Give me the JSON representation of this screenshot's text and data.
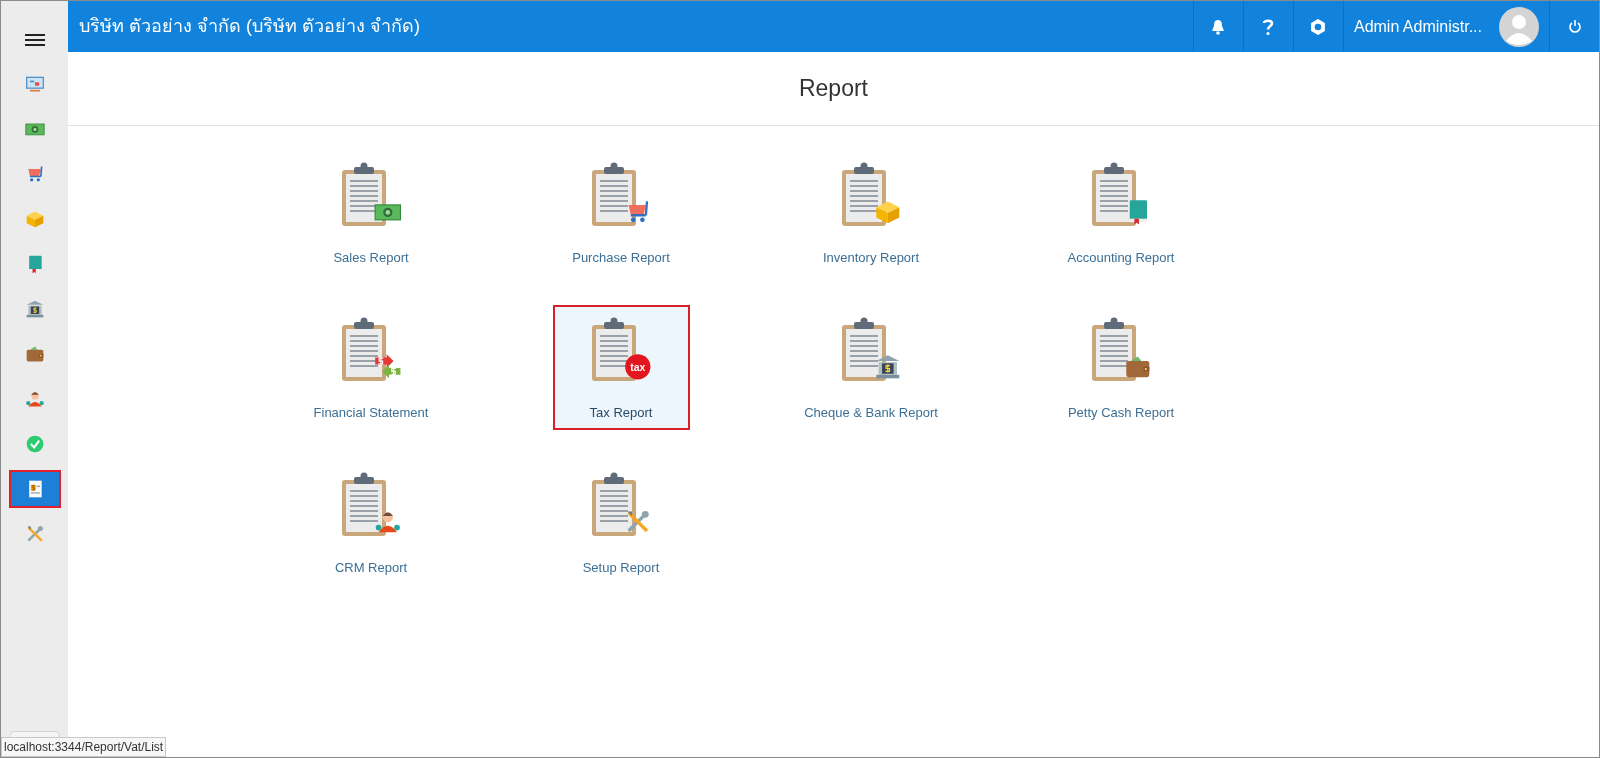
{
  "header": {
    "company": "บริษัท ตัวอย่าง จำกัด (บริษัท ตัวอย่าง จำกัด)",
    "user": "Admin Administr..."
  },
  "sidebar": {
    "items": [
      {
        "kind": "dashboard",
        "selected": false
      },
      {
        "kind": "money",
        "selected": false
      },
      {
        "kind": "cart",
        "selected": false
      },
      {
        "kind": "box",
        "selected": false
      },
      {
        "kind": "book",
        "selected": false
      },
      {
        "kind": "bank",
        "selected": false
      },
      {
        "kind": "wallet",
        "selected": false
      },
      {
        "kind": "people",
        "selected": false
      },
      {
        "kind": "check",
        "selected": false
      },
      {
        "kind": "report",
        "selected": true
      },
      {
        "kind": "tools",
        "selected": false
      }
    ]
  },
  "page": {
    "title": "Report"
  },
  "reports": [
    {
      "label": "Sales Report",
      "kind": "money",
      "selected": false
    },
    {
      "label": "Purchase Report",
      "kind": "cart",
      "selected": false
    },
    {
      "label": "Inventory Report",
      "kind": "box",
      "selected": false
    },
    {
      "label": "Accounting Report",
      "kind": "book",
      "selected": false
    },
    {
      "label": "Financial Statement",
      "kind": "exchange",
      "selected": false
    },
    {
      "label": "Tax Report",
      "kind": "tax",
      "badge": "tax",
      "selected": true
    },
    {
      "label": "Cheque & Bank Report",
      "kind": "bank",
      "selected": false
    },
    {
      "label": "Petty Cash Report",
      "kind": "wallet",
      "selected": false
    },
    {
      "label": "CRM Report",
      "kind": "people",
      "selected": false
    },
    {
      "label": "Setup Report",
      "kind": "tools",
      "selected": false
    }
  ],
  "status_url": "localhost:3344/Report/Vat/List"
}
